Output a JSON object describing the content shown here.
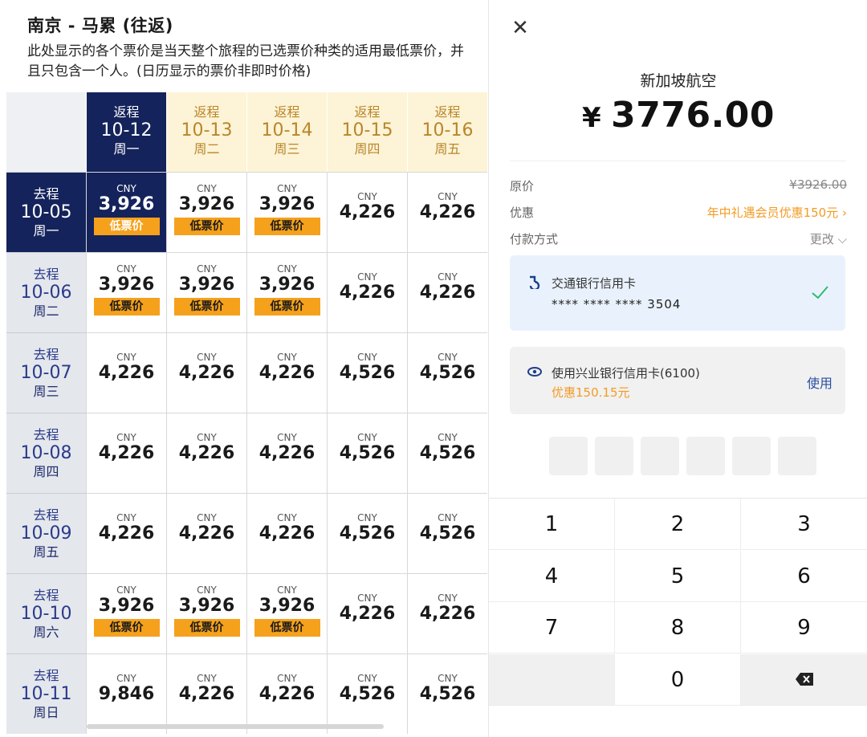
{
  "left": {
    "title": "南京 - 马累 (往返)",
    "note": "此处显示的各个票价是当天整个旅程的已选票价种类的适用最低票价，并且只包含一个人。(日历显示的票价非即时价格)",
    "return_label": "返程",
    "depart_label": "去程",
    "currency": "CNY",
    "low_badge": "低票价",
    "return_dates": [
      {
        "date": "10-12",
        "weekday": "周一"
      },
      {
        "date": "10-13",
        "weekday": "周二"
      },
      {
        "date": "10-14",
        "weekday": "周三"
      },
      {
        "date": "10-15",
        "weekday": "周四"
      },
      {
        "date": "10-16",
        "weekday": "周五"
      }
    ],
    "rows": [
      {
        "date": "10-05",
        "weekday": "周一",
        "prices": [
          "3,926",
          "3,926",
          "3,926",
          "4,226",
          "4,226"
        ],
        "low": [
          true,
          true,
          true,
          false,
          false
        ]
      },
      {
        "date": "10-06",
        "weekday": "周二",
        "prices": [
          "3,926",
          "3,926",
          "3,926",
          "4,226",
          "4,226"
        ],
        "low": [
          true,
          true,
          true,
          false,
          false
        ]
      },
      {
        "date": "10-07",
        "weekday": "周三",
        "prices": [
          "4,226",
          "4,226",
          "4,226",
          "4,526",
          "4,526"
        ],
        "low": [
          false,
          false,
          false,
          false,
          false
        ]
      },
      {
        "date": "10-08",
        "weekday": "周四",
        "prices": [
          "4,226",
          "4,226",
          "4,226",
          "4,526",
          "4,526"
        ],
        "low": [
          false,
          false,
          false,
          false,
          false
        ]
      },
      {
        "date": "10-09",
        "weekday": "周五",
        "prices": [
          "4,226",
          "4,226",
          "4,226",
          "4,526",
          "4,526"
        ],
        "low": [
          false,
          false,
          false,
          false,
          false
        ]
      },
      {
        "date": "10-10",
        "weekday": "周六",
        "prices": [
          "3,926",
          "3,926",
          "3,926",
          "4,226",
          "4,226"
        ],
        "low": [
          true,
          true,
          true,
          false,
          false
        ]
      },
      {
        "date": "10-11",
        "weekday": "周日",
        "prices": [
          "9,846",
          "4,226",
          "4,226",
          "4,526",
          "4,526"
        ],
        "low": [
          false,
          false,
          false,
          false,
          false
        ]
      }
    ]
  },
  "payment": {
    "close_icon": "close-icon",
    "merchant": "新加坡航空",
    "currency_symbol": "¥",
    "amount": "3776.00",
    "original_label": "原价",
    "original_value": "¥3926.00",
    "discount_label": "优惠",
    "discount_value": "年中礼遇会员优惠150元 ›",
    "method_label": "付款方式",
    "method_change": "更改 ⌵",
    "card1_name": "交通银行信用卡",
    "card1_number": "**** **** **** 3504",
    "card2_name": "使用兴业银行信用卡(6100)",
    "card2_promo": "优惠150.15元",
    "card2_use": "使用",
    "keys": [
      "1",
      "2",
      "3",
      "4",
      "5",
      "6",
      "7",
      "8",
      "9",
      "",
      "0",
      ""
    ],
    "accent": "#f39b24",
    "check_color": "#2dbb6e"
  }
}
